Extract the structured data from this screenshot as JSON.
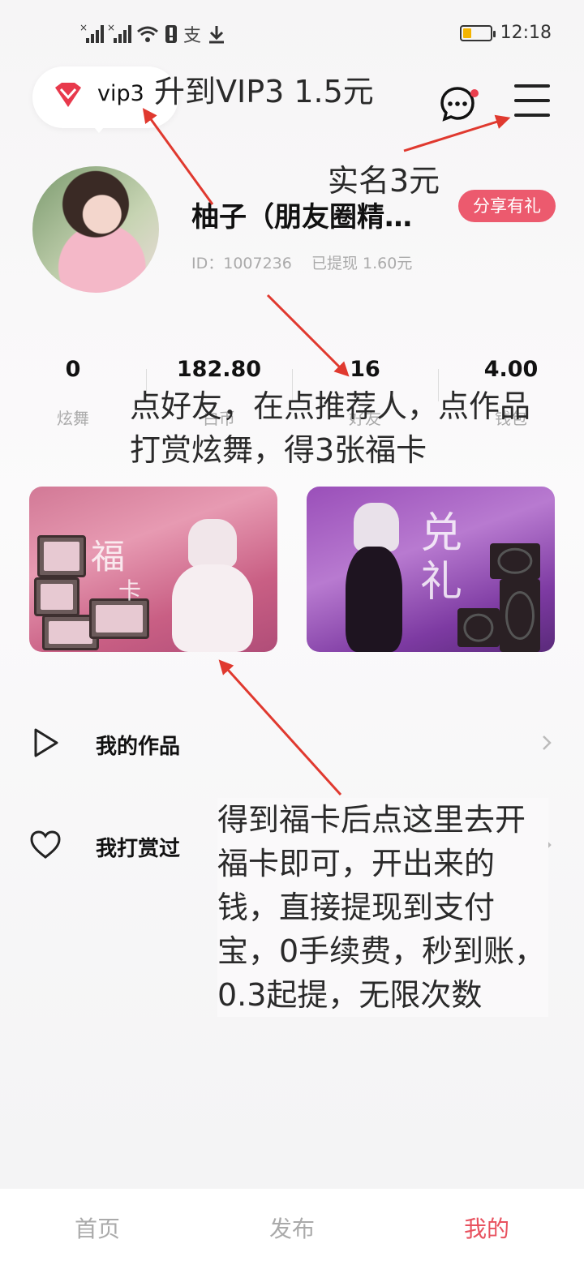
{
  "status_bar": {
    "time": "12:18"
  },
  "vip": {
    "label": "vip3"
  },
  "annotations": {
    "upgrade_vip": "升到VIP3 1.5元",
    "real_name": "实名3元",
    "friend_steps": [
      "点好友，在点推荐人，点作品",
      "打赏炫舞，得3张福卡"
    ],
    "open_card": [
      "得到福卡后点这里去开",
      "福卡即可，开出来的",
      "钱，直接提现到支付",
      "宝，0手续费，秒到账，",
      "0.3起提，无限次数"
    ]
  },
  "profile": {
    "username": "柚子（朋友圈精…",
    "share_badge": "分享有礼",
    "id_text": "ID：1007236",
    "withdrawn_text": "已提现 1.60元"
  },
  "stats": [
    {
      "value": "0",
      "label": "炫舞"
    },
    {
      "value": "182.80",
      "label": "白币"
    },
    {
      "value": "16",
      "label": "好友"
    },
    {
      "value": "4.00",
      "label": "钱包"
    }
  ],
  "cards": {
    "fuka": {
      "text": [
        "福",
        "卡"
      ]
    },
    "duili": {
      "text": [
        "兑",
        "礼"
      ]
    }
  },
  "list": [
    {
      "label": "我的作品",
      "icon": "play-icon"
    },
    {
      "label": "我打赏过",
      "icon": "heart-icon"
    }
  ],
  "nav": [
    {
      "label": "首页"
    },
    {
      "label": "发布"
    },
    {
      "label": "我的"
    }
  ],
  "colors": {
    "accent": "#e8525f",
    "badge": "#ec5a6e",
    "arrow": "#e0392f"
  }
}
